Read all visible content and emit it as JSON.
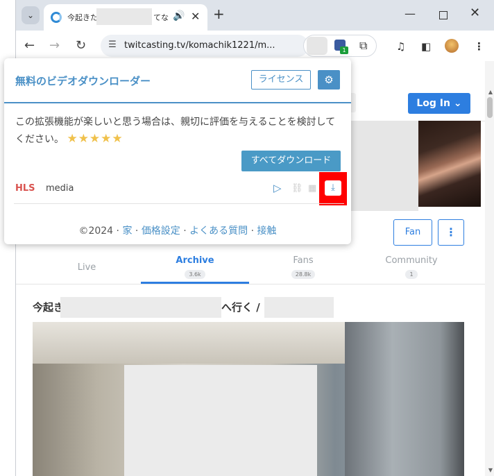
{
  "browser": {
    "tab": {
      "title_start": "今起きた",
      "title_end": "てな",
      "audio_icon": "speaker-icon"
    },
    "omnibox": {
      "url": "twitcasting.tv/komachik1221/m..."
    },
    "extension_badge": "1"
  },
  "site": {
    "login_label": "Log In",
    "fan_label": "Fan",
    "tabs": [
      {
        "label": "Live",
        "count": ""
      },
      {
        "label": "Archive",
        "count": "3.6k"
      },
      {
        "label": "Fans",
        "count": "28.8k"
      },
      {
        "label": "Community",
        "count": "1"
      }
    ],
    "movie_title_start": "今起き",
    "movie_title_mid": "へ行く /"
  },
  "popup": {
    "title": "無料のビデオダウンローダー",
    "license_label": "ライセンス",
    "message": "この拡張機能が楽しいと思う場合は、親切に評価を与えることを検討してください。",
    "stars": "★★★★★",
    "download_all_label": "すべてダウンロード",
    "item": {
      "format": "HLS",
      "name": "media"
    },
    "footer": {
      "copyright": "©2024",
      "links": [
        "家",
        "価格設定",
        "よくある質問",
        "接触"
      ]
    }
  },
  "colors": {
    "accent": "#4a90c6",
    "brand_blue": "#2d7ee0",
    "highlight": "#ff0000",
    "hls": "#d9534f"
  }
}
